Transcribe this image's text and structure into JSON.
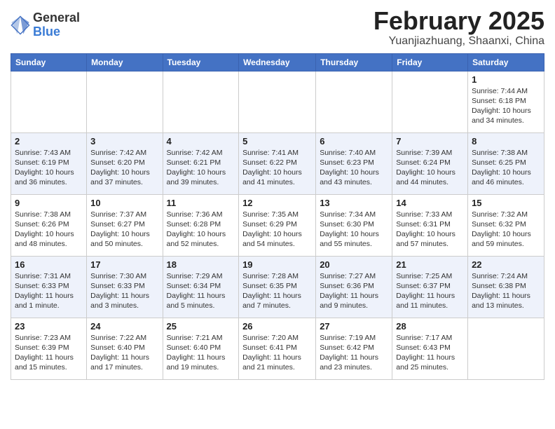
{
  "header": {
    "logo_general": "General",
    "logo_blue": "Blue",
    "month_title": "February 2025",
    "location": "Yuanjiazhuang, Shaanxi, China"
  },
  "days_of_week": [
    "Sunday",
    "Monday",
    "Tuesday",
    "Wednesday",
    "Thursday",
    "Friday",
    "Saturday"
  ],
  "weeks": [
    [
      {
        "day": "",
        "info": ""
      },
      {
        "day": "",
        "info": ""
      },
      {
        "day": "",
        "info": ""
      },
      {
        "day": "",
        "info": ""
      },
      {
        "day": "",
        "info": ""
      },
      {
        "day": "",
        "info": ""
      },
      {
        "day": "1",
        "info": "Sunrise: 7:44 AM\nSunset: 6:18 PM\nDaylight: 10 hours and 34 minutes."
      }
    ],
    [
      {
        "day": "2",
        "info": "Sunrise: 7:43 AM\nSunset: 6:19 PM\nDaylight: 10 hours and 36 minutes."
      },
      {
        "day": "3",
        "info": "Sunrise: 7:42 AM\nSunset: 6:20 PM\nDaylight: 10 hours and 37 minutes."
      },
      {
        "day": "4",
        "info": "Sunrise: 7:42 AM\nSunset: 6:21 PM\nDaylight: 10 hours and 39 minutes."
      },
      {
        "day": "5",
        "info": "Sunrise: 7:41 AM\nSunset: 6:22 PM\nDaylight: 10 hours and 41 minutes."
      },
      {
        "day": "6",
        "info": "Sunrise: 7:40 AM\nSunset: 6:23 PM\nDaylight: 10 hours and 43 minutes."
      },
      {
        "day": "7",
        "info": "Sunrise: 7:39 AM\nSunset: 6:24 PM\nDaylight: 10 hours and 44 minutes."
      },
      {
        "day": "8",
        "info": "Sunrise: 7:38 AM\nSunset: 6:25 PM\nDaylight: 10 hours and 46 minutes."
      }
    ],
    [
      {
        "day": "9",
        "info": "Sunrise: 7:38 AM\nSunset: 6:26 PM\nDaylight: 10 hours and 48 minutes."
      },
      {
        "day": "10",
        "info": "Sunrise: 7:37 AM\nSunset: 6:27 PM\nDaylight: 10 hours and 50 minutes."
      },
      {
        "day": "11",
        "info": "Sunrise: 7:36 AM\nSunset: 6:28 PM\nDaylight: 10 hours and 52 minutes."
      },
      {
        "day": "12",
        "info": "Sunrise: 7:35 AM\nSunset: 6:29 PM\nDaylight: 10 hours and 54 minutes."
      },
      {
        "day": "13",
        "info": "Sunrise: 7:34 AM\nSunset: 6:30 PM\nDaylight: 10 hours and 55 minutes."
      },
      {
        "day": "14",
        "info": "Sunrise: 7:33 AM\nSunset: 6:31 PM\nDaylight: 10 hours and 57 minutes."
      },
      {
        "day": "15",
        "info": "Sunrise: 7:32 AM\nSunset: 6:32 PM\nDaylight: 10 hours and 59 minutes."
      }
    ],
    [
      {
        "day": "16",
        "info": "Sunrise: 7:31 AM\nSunset: 6:33 PM\nDaylight: 11 hours and 1 minute."
      },
      {
        "day": "17",
        "info": "Sunrise: 7:30 AM\nSunset: 6:33 PM\nDaylight: 11 hours and 3 minutes."
      },
      {
        "day": "18",
        "info": "Sunrise: 7:29 AM\nSunset: 6:34 PM\nDaylight: 11 hours and 5 minutes."
      },
      {
        "day": "19",
        "info": "Sunrise: 7:28 AM\nSunset: 6:35 PM\nDaylight: 11 hours and 7 minutes."
      },
      {
        "day": "20",
        "info": "Sunrise: 7:27 AM\nSunset: 6:36 PM\nDaylight: 11 hours and 9 minutes."
      },
      {
        "day": "21",
        "info": "Sunrise: 7:25 AM\nSunset: 6:37 PM\nDaylight: 11 hours and 11 minutes."
      },
      {
        "day": "22",
        "info": "Sunrise: 7:24 AM\nSunset: 6:38 PM\nDaylight: 11 hours and 13 minutes."
      }
    ],
    [
      {
        "day": "23",
        "info": "Sunrise: 7:23 AM\nSunset: 6:39 PM\nDaylight: 11 hours and 15 minutes."
      },
      {
        "day": "24",
        "info": "Sunrise: 7:22 AM\nSunset: 6:40 PM\nDaylight: 11 hours and 17 minutes."
      },
      {
        "day": "25",
        "info": "Sunrise: 7:21 AM\nSunset: 6:40 PM\nDaylight: 11 hours and 19 minutes."
      },
      {
        "day": "26",
        "info": "Sunrise: 7:20 AM\nSunset: 6:41 PM\nDaylight: 11 hours and 21 minutes."
      },
      {
        "day": "27",
        "info": "Sunrise: 7:19 AM\nSunset: 6:42 PM\nDaylight: 11 hours and 23 minutes."
      },
      {
        "day": "28",
        "info": "Sunrise: 7:17 AM\nSunset: 6:43 PM\nDaylight: 11 hours and 25 minutes."
      },
      {
        "day": "",
        "info": ""
      }
    ]
  ]
}
